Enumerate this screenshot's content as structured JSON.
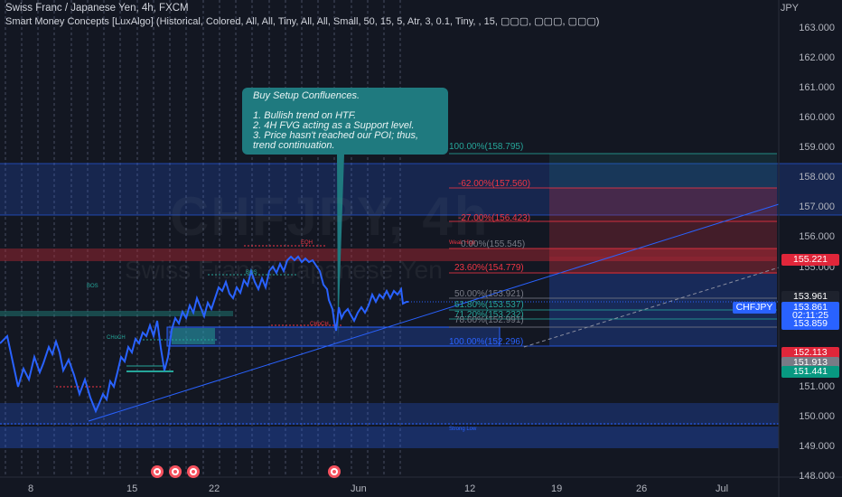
{
  "header": {
    "symbol_line": "Swiss Franc / Japanese Yen, 4h, FXCM",
    "indicator_line": "Smart Money Concepts [LuxAlgo] (Historical, Colored, All, All, Tiny, All, All, Small, 50, 15, 5, Atr, 3, 0.1, Tiny, , 15, ▢▢▢, ▢▢▢, ▢▢▢)"
  },
  "watermark": {
    "big": "CHFJPY, 4h",
    "small": "Swiss Franc / Japanese Yen"
  },
  "price_axis": {
    "currency": "JPY",
    "ticks": [
      "163.000",
      "162.000",
      "161.000",
      "160.000",
      "159.000",
      "158.000",
      "157.000",
      "156.000",
      "155.000",
      "154.000",
      "153.000",
      "152.000",
      "151.000",
      "150.000",
      "149.000",
      "148.000"
    ]
  },
  "price_tags": [
    {
      "text": "155.221",
      "color": "#e0263a"
    },
    {
      "text": "153.961",
      "color": "#1e222d"
    },
    {
      "text": "153.861",
      "color": "#2962ff"
    },
    {
      "text": "02:11:25",
      "color": "#2962ff"
    },
    {
      "text": "153.859",
      "color": "#2962ff"
    },
    {
      "text": "152.113",
      "color": "#e0263a"
    },
    {
      "text": "151.913",
      "color": "#787b86"
    },
    {
      "text": "151.441",
      "color": "#089981"
    }
  ],
  "symbol_tag": "CHFJPY",
  "time_axis": [
    "8",
    "15",
    "22",
    "Jun",
    "12",
    "19",
    "26",
    "Jul"
  ],
  "callout": {
    "title": "Buy Setup Confluences.",
    "lines": [
      "1. Bullish trend on HTF.",
      "2. 4H FVG acting as a Support level.",
      "3. Price hasn't reached our POI; thus, trend continuation."
    ]
  },
  "fib_levels": [
    {
      "label": "100.00%(158.795)",
      "color": "#26a69a"
    },
    {
      "label": "-62.00%(157.560)",
      "color": "#f23645"
    },
    {
      "label": "-27.00%(156.423)",
      "color": "#f23645"
    },
    {
      "label": "0.00%(155.545)",
      "color": "#787b86"
    },
    {
      "label": "23.60%(154.779)",
      "color": "#f23645"
    },
    {
      "label": "50.00%(153.921)",
      "color": "#787b86"
    },
    {
      "label": "61.80%(153.537)",
      "color": "#26a69a"
    },
    {
      "label": "71.20%(153.232)",
      "color": "#26a69a"
    },
    {
      "label": "78.60%(152.991)",
      "color": "#787b86"
    },
    {
      "label": "100.00%(152.296)",
      "color": "#2962ff"
    }
  ],
  "smc_labels": {
    "bos1": "BOS",
    "bos2": "BOS",
    "choch": "CHoCH",
    "choch2": "CHoCH",
    "eqh": "EQH",
    "weak_high": "Weak High",
    "strong_low": "Strong Low"
  },
  "icon_names": [
    "event-icon",
    "event-icon",
    "event-icon",
    "event-icon"
  ],
  "colors": {
    "background": "#131722",
    "line": "#2962ff",
    "callout": "#1f7a7f",
    "bear": "#f23645",
    "bull": "#26a69a"
  }
}
